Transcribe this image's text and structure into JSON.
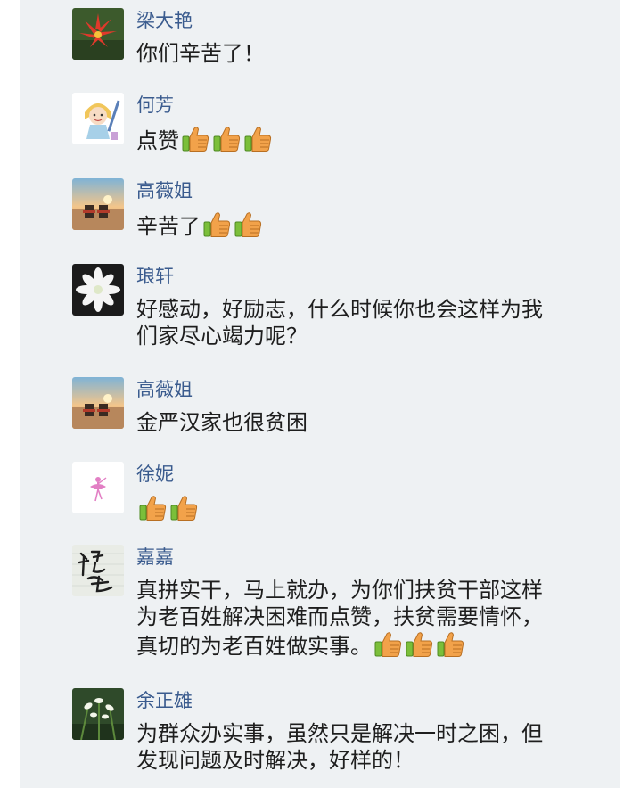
{
  "comments": [
    {
      "name": "梁大艳",
      "text": "你们辛苦了！",
      "thumbs": 0,
      "avatar": "red-flower-avatar"
    },
    {
      "name": "何芳",
      "text": "点赞",
      "thumbs": 3,
      "avatar": "cartoon-girl-avatar"
    },
    {
      "name": "高薇姐",
      "text": "辛苦了",
      "thumbs": 2,
      "avatar": "sunset-beach-avatar"
    },
    {
      "name": "琅轩",
      "text": "好感动，好励志，什么时候你也会这样为我\n们家尽心竭力呢？",
      "thumbs": 0,
      "avatar": "white-flower-avatar"
    },
    {
      "name": "高薇姐",
      "text": "金严汉家也很贫困",
      "thumbs": 0,
      "avatar": "sunset-beach-avatar"
    },
    {
      "name": "徐妮",
      "text": "",
      "thumbs": 2,
      "avatar": "ballerina-avatar"
    },
    {
      "name": "嘉嘉",
      "text": "真拼实干，马上就办，为你们扶贫干部这样\n为老百姓解决困难而点赞，扶贫需要情怀，\n真切的为老百姓做实事。",
      "thumbs": 3,
      "avatar": "calligraphy-avatar"
    },
    {
      "name": "余正雄",
      "text": "为群众办实事，虽然只是解决一时之困，但\n发现问题及时解决，好样的！",
      "thumbs": 0,
      "avatar": "white-orchid-avatar"
    }
  ],
  "colors": {
    "background": "#eef1f3",
    "name": "#3a5b8e",
    "text": "#1e1e1e",
    "thumb": "#f2a24a"
  }
}
